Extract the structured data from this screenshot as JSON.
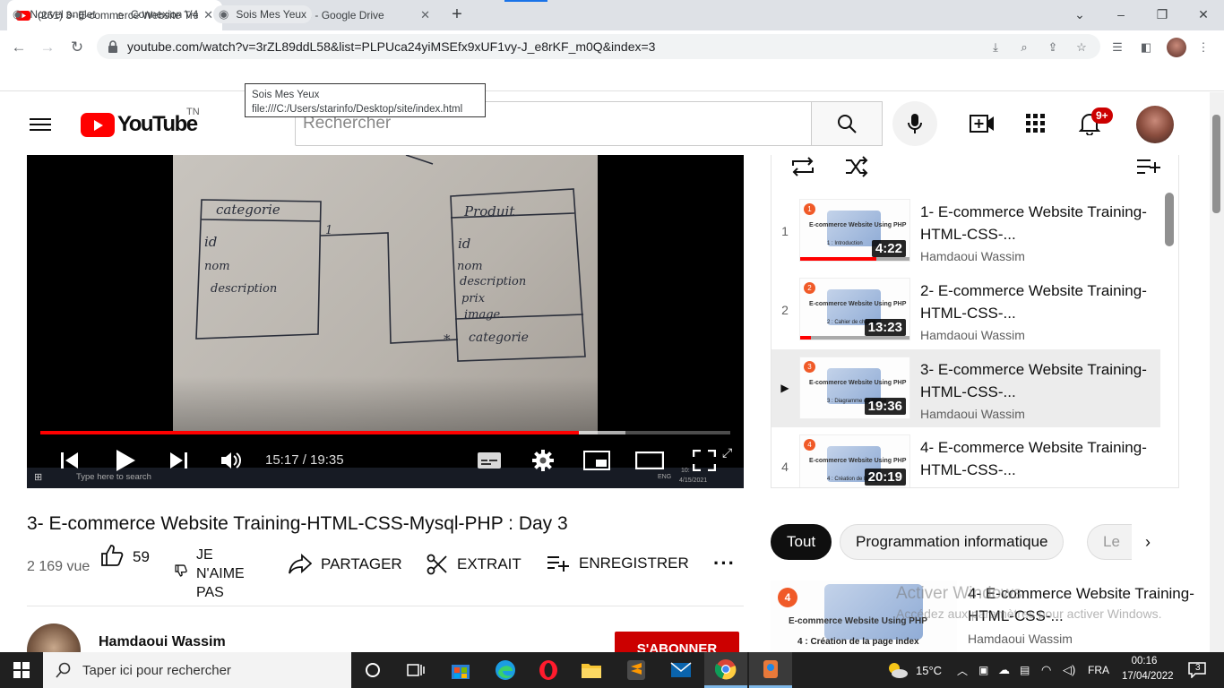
{
  "browser": {
    "tabs": [
      {
        "title": "(261) 3- E-commerce Website Tra",
        "active": true
      },
      {
        "title": "myposte.zip - Google Drive",
        "active": false
      }
    ],
    "url": "youtube.com/watch?v=3rZL89ddL58&list=PLPUca24yiMSEfx9xUF1vy-J_e8rKF_m0Q&index=3",
    "bookmarks": [
      {
        "label": "Nouvel onglet",
        "icon": "globe-icon"
      },
      {
        "label": "Connexion V4",
        "icon": "home-icon"
      },
      {
        "label": "Sois Mes Yeux",
        "icon": "globe-icon"
      }
    ],
    "tooltip": {
      "line1": "Sois Mes Yeux",
      "line2": "file:///C:/Users/starinfo/Desktop/site/index.html"
    }
  },
  "youtube": {
    "logo_text": "YouTube",
    "country": "TN",
    "search_placeholder": "Rechercher",
    "notif_count": "9+",
    "video": {
      "time": "15:17 / 19:35",
      "progress": 0.781,
      "buffered": 0.848,
      "diagram": {
        "left_table": {
          "name": "categorie",
          "fields": [
            "id",
            "nom",
            "description"
          ]
        },
        "right_table": {
          "name": "Produit",
          "fields": [
            "id",
            "nom",
            "description",
            "prix",
            "image.",
            "categorie"
          ]
        },
        "mult_left": "1",
        "mult_right": "*"
      },
      "inner_taskbar": {
        "search": "Type here to search",
        "date_time": "10:",
        "date": "4/15/2021",
        "lang": "ENG"
      }
    },
    "title": "3- E-commerce Website Training-HTML-CSS-Mysql-PHP : Day 3",
    "views": "2 169 vue",
    "likes": "59",
    "actions": {
      "dislike": "JE N'AIME PAS",
      "share": "PARTAGER",
      "clip": "EXTRAIT",
      "save": "ENREGISTRER"
    },
    "channel": {
      "name": "Hamdaoui Wassim",
      "subscribe": "S'ABONNER"
    },
    "playlist": [
      {
        "index": "1",
        "title": "1- E-commerce Website Training-HTML-CSS-...",
        "channel": "Hamdaoui Wassim",
        "duration": "4:22",
        "watched": 0.7,
        "badge": "1",
        "thumb_caption": "E-commerce Website Using PHP",
        "thumb_label": "1 : Introduction"
      },
      {
        "index": "2",
        "title": "2- E-commerce Website Training-HTML-CSS-...",
        "channel": "Hamdaoui Wassim",
        "duration": "13:23",
        "watched": 0.1,
        "badge": "2",
        "thumb_caption": "E-commerce Website Using PHP",
        "thumb_label": "2 : Cahier de charge"
      },
      {
        "index": "▶",
        "title": "3- E-commerce Website Training-HTML-CSS-...",
        "channel": "Hamdaoui Wassim",
        "duration": "19:36",
        "watched": 0,
        "badge": "3",
        "thumb_caption": "E-commerce Website Using PHP",
        "thumb_label": "3 : Diagramme de classe",
        "selected": true
      },
      {
        "index": "4",
        "title": "4- E-commerce Website Training-HTML-CSS-...",
        "channel": "Hamdaoui Wassim",
        "duration": "20:19",
        "watched": 0,
        "badge": "4",
        "thumb_caption": "E-commerce Website Using PHP",
        "thumb_label": "4 : Création de la page index"
      }
    ],
    "chips": [
      "Tout",
      "Programmation informatique",
      "Le"
    ],
    "recommendation": {
      "title": "4- E-commerce Website Training-HTML-CSS-...",
      "channel": "Hamdaoui Wassim",
      "badge": "4",
      "thumb_caption": "E-commerce Website Using PHP",
      "thumb_label": "4 : Création de la page index"
    },
    "activation_watermark": {
      "line1": "Activer Windows",
      "line2": "Accédez aux paramètres pour activer Windows."
    }
  },
  "taskbar": {
    "search_placeholder": "Taper ici pour rechercher",
    "weather": "15°C",
    "lang": "FRA",
    "time": "00:16",
    "date": "17/04/2022",
    "notifications": "3"
  }
}
